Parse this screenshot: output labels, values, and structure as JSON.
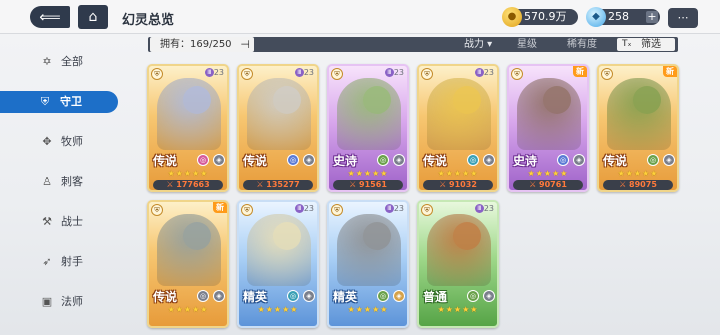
{
  "header": {
    "title": "幻灵总览",
    "gold": "570.9万",
    "gems": "258",
    "gem_plus": "+"
  },
  "filter": {
    "owned_label": "拥有：169/250",
    "sort_power": "战力 ▾",
    "sort_star": "星级",
    "sort_rarity": "稀有度",
    "filter_label": "筛选",
    "filter_icon": "Tₓ"
  },
  "sidebar": {
    "items": [
      {
        "label": "全部",
        "icon": "star-of-david-icon",
        "glyph": "✡"
      },
      {
        "label": "守卫",
        "icon": "shield-icon",
        "glyph": "⛨"
      },
      {
        "label": "牧师",
        "icon": "wings-icon",
        "glyph": "✥"
      },
      {
        "label": "刺客",
        "icon": "mask-icon",
        "glyph": "♙"
      },
      {
        "label": "战士",
        "icon": "axe-icon",
        "glyph": "⚒"
      },
      {
        "label": "射手",
        "icon": "bow-icon",
        "glyph": "➶"
      },
      {
        "label": "法师",
        "icon": "book-icon",
        "glyph": "▣"
      }
    ],
    "active_index": 1
  },
  "heroes": [
    {
      "rank": "传说",
      "rarity": "legend",
      "power": "177663",
      "stars": "★★★★★",
      "new": false,
      "elem1": "#d55a9a",
      "elem2": "#7a7f8c",
      "art": "#a7b6e0"
    },
    {
      "rank": "传说",
      "rarity": "legend",
      "power": "135277",
      "stars": "",
      "new": false,
      "elem1": "#5a7ad5",
      "elem2": "#7a7f8c",
      "art": "#c9c9c9"
    },
    {
      "rank": "史诗",
      "rarity": "epic",
      "power": "91561",
      "stars": "★★★★★",
      "new": false,
      "elem1": "#6aa14a",
      "elem2": "#7a7f8c",
      "art": "#8fb86a"
    },
    {
      "rank": "传说",
      "rarity": "legend",
      "power": "91032",
      "stars": "★★★★★",
      "new": false,
      "elem1": "#3aa0b5",
      "elem2": "#7a7f8c",
      "art": "#e8c24a"
    },
    {
      "rank": "史诗",
      "rarity": "epic",
      "power": "90761",
      "stars": "★★★★★",
      "new": true,
      "elem1": "#5a7ad5",
      "elem2": "#7a7f8c",
      "art": "#8a6a5a"
    },
    {
      "rank": "传说",
      "rarity": "legend",
      "power": "89075",
      "stars": "★★★★★",
      "new": true,
      "elem1": "#6aa14a",
      "elem2": "#7a7f8c",
      "art": "#7a9a4a"
    },
    {
      "rank": "传说",
      "rarity": "legend",
      "power": "",
      "stars": "★★★★★",
      "new": true,
      "elem1": "#7a7f8c",
      "elem2": "#7a7f8c",
      "art": "#8a9aa0"
    },
    {
      "rank": "精英",
      "rarity": "elite",
      "power": "",
      "stars": "★★★★★",
      "new": false,
      "elem1": "#3aa0b5",
      "elem2": "#7a7f8c",
      "art": "#e8dcb0"
    },
    {
      "rank": "精英",
      "rarity": "elite",
      "power": "",
      "stars": "★★★★★",
      "new": false,
      "elem1": "#6aa14a",
      "elem2": "#d5a24a",
      "art": "#8a8a8a"
    },
    {
      "rank": "普通",
      "rarity": "common",
      "power": "",
      "stars": "★★★★★",
      "new": false,
      "elem1": "#6aa14a",
      "elem2": "#7a7f8c",
      "art": "#c0723a"
    }
  ],
  "new_badge": "新",
  "level_text": "23",
  "power_prefix": "⚔ "
}
